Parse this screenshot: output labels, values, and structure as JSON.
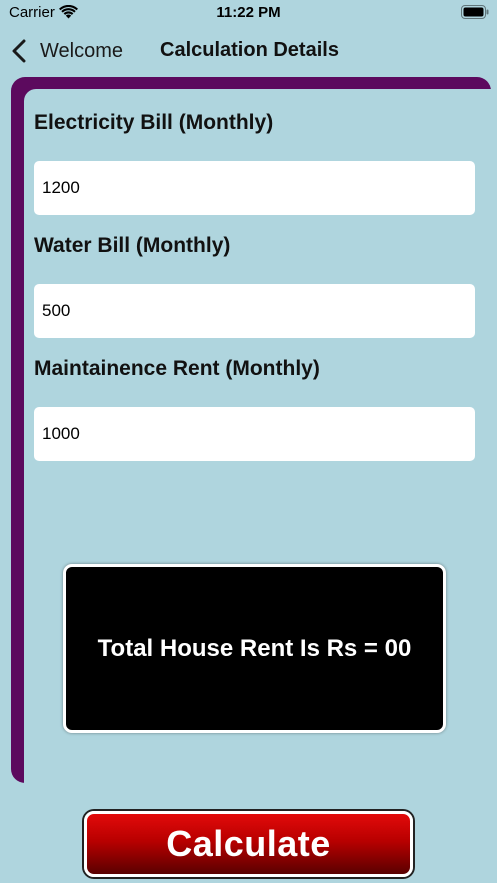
{
  "status_bar": {
    "carrier": "Carrier",
    "time": "11:22 PM",
    "wifi_icon": "wifi-icon",
    "battery_icon": "battery-icon"
  },
  "nav": {
    "back_label": "Welcome",
    "back_icon": "chevron-left-icon",
    "title": "Calculation Details"
  },
  "form": {
    "electricity": {
      "label": "Electricity Bill (Monthly)",
      "value": "1200"
    },
    "water": {
      "label": "Water Bill (Monthly)",
      "value": "500"
    },
    "maintenance": {
      "label": "Maintainence Rent (Monthly)",
      "value": "1000"
    }
  },
  "result": {
    "text": "Total House Rent Is Rs = 00"
  },
  "actions": {
    "calculate_label": "Calculate"
  },
  "colors": {
    "background": "#afd5de",
    "card_accent": "#5c0a5e",
    "button_red": "#d00000",
    "result_bg": "#000000"
  }
}
